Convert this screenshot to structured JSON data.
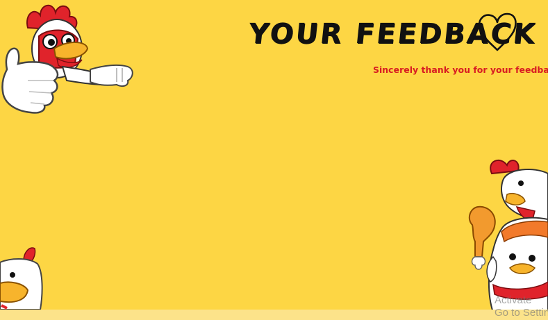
{
  "header": {
    "title": "YOUR FEEDBACK",
    "subtitle": "Sincerely thank you for your feedback."
  },
  "icons": {
    "heart": "heart-icon",
    "mascot_top_left": "rooster-thumbs-up-mascot",
    "mascot_bottom_left": "chicken-peek-mascot",
    "mascot_bottom_right": "chicken-drumstick-mascot"
  },
  "colors": {
    "background": "#fdd644",
    "title": "#111111",
    "subtitle": "#d81b22"
  },
  "watermark": {
    "line1": "Activate",
    "line2": "Go to Settin"
  }
}
